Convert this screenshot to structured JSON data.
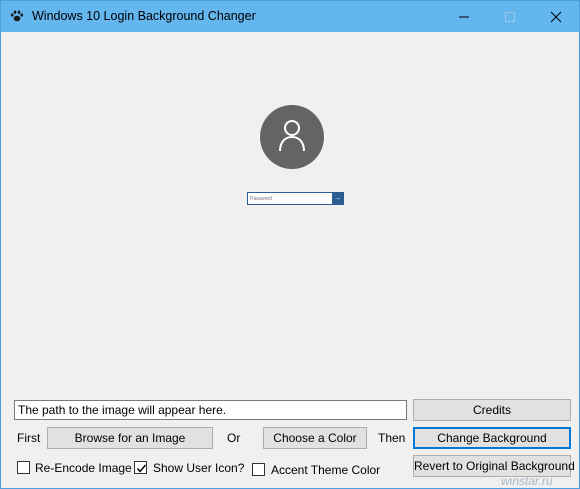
{
  "window": {
    "title": "Windows 10 Login Background Changer"
  },
  "preview": {
    "password_placeholder": "Password",
    "submit_glyph": "→"
  },
  "controls": {
    "path_text": "The path to the image will appear here.",
    "credits_label": "Credits",
    "first_label": "First",
    "browse_label": "Browse for an Image",
    "or_label": "Or",
    "color_label": "Choose a Color",
    "then_label": "Then",
    "change_label": "Change Background",
    "reencode_label": "Re-Encode Image",
    "reencode_checked": false,
    "show_icon_label": "Show User Icon?",
    "show_icon_checked": true,
    "accent_label": "Accent Theme Color",
    "accent_checked": false,
    "revert_label": "Revert to Original Background"
  },
  "watermark": "winstar.ru",
  "colors": {
    "titlebar": "#63b6ee",
    "accent": "#0078d7",
    "avatar": "#646464",
    "password_box": "#2b5d93"
  },
  "icons": [
    "paw-icon",
    "minimize-icon",
    "maximize-icon",
    "close-icon",
    "user-icon",
    "arrow-right-icon",
    "checkmark-icon"
  ]
}
